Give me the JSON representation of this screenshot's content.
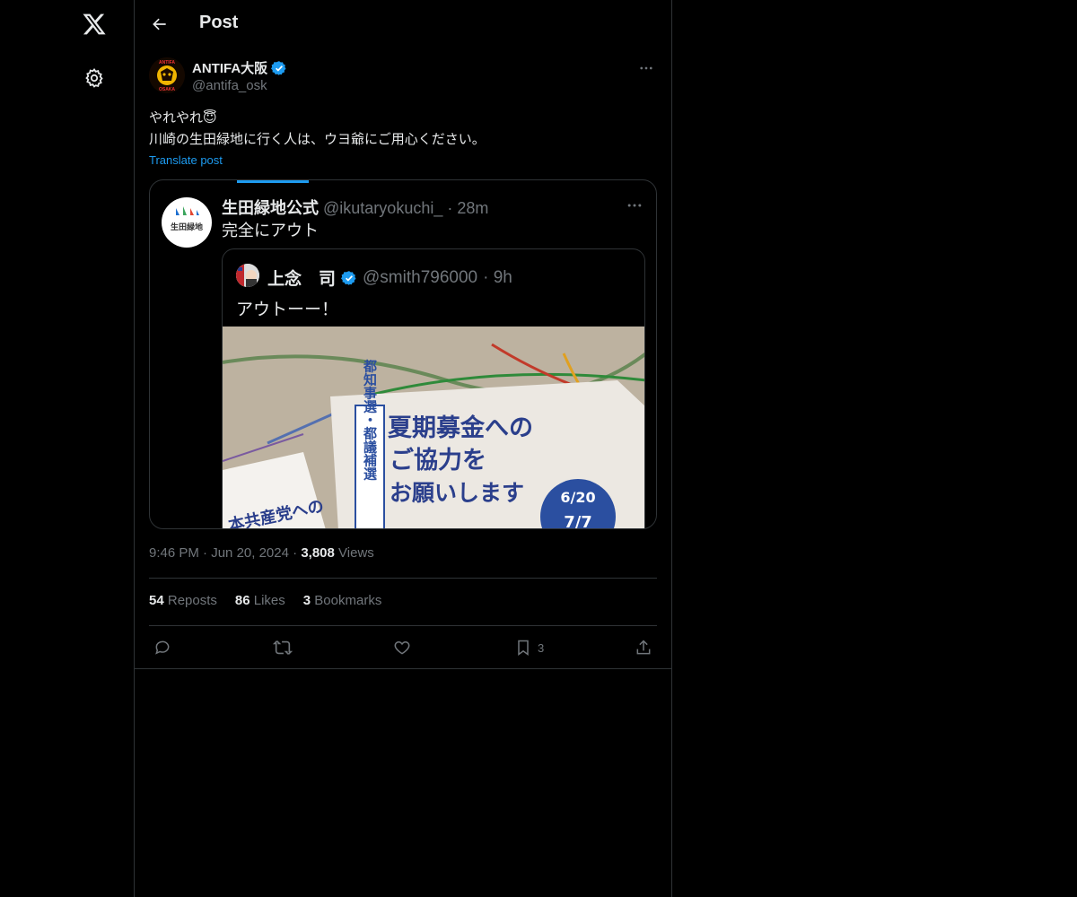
{
  "sidebar": {
    "logo_icon": "x-logo-icon",
    "settings_icon": "gear-icon"
  },
  "header": {
    "title": "Post",
    "back_icon": "arrow-left-icon"
  },
  "post": {
    "author_name": "ANTIFA大阪",
    "author_handle": "@antifa_osk",
    "verified": true,
    "text": "やれやれ😇\n川崎の生田緑地に行く人は、ウヨ爺にご用心ください。",
    "translate_label": "Translate post",
    "avatar_text_top": "ANTIFA",
    "avatar_text_bottom": "OSAKA"
  },
  "quote": {
    "name": "生田緑地公式",
    "handle": "@ikutaryokuchi_",
    "time": "· 28m",
    "text": "完全にアウト",
    "avatar_label": "生田緑地",
    "inner": {
      "name": "上念　司",
      "handle": "@smith796000",
      "time": "· 9h",
      "text": "アウトーー！",
      "verified": true
    },
    "photo": {
      "vertical_label": "都知事選・都議補選",
      "headline_1": "夏期募金への",
      "headline_2": "ご協力を",
      "headline_3": "お願いします",
      "badge_1": "6/20",
      "badge_2": "7/7",
      "left_text": "本共産党への"
    }
  },
  "meta": {
    "time": "9:46 PM",
    "sep1": "·",
    "date": "Jun 20, 2024",
    "sep2": "·",
    "views_count": "3,808",
    "views_label": "Views"
  },
  "stats": {
    "reposts_count": "54",
    "reposts_label": "Reposts",
    "likes_count": "86",
    "likes_label": "Likes",
    "bookmarks_count": "3",
    "bookmarks_label": "Bookmarks"
  },
  "actions": {
    "reply_icon": "reply-icon",
    "repost_icon": "repost-icon",
    "like_icon": "heart-icon",
    "bookmark_icon": "bookmark-icon",
    "bookmark_count": "3",
    "share_icon": "share-icon"
  },
  "colors": {
    "accent": "#1d9bf0",
    "background": "#000000",
    "text": "#e7e9ea",
    "muted": "#71767b",
    "border": "#2f3336"
  }
}
